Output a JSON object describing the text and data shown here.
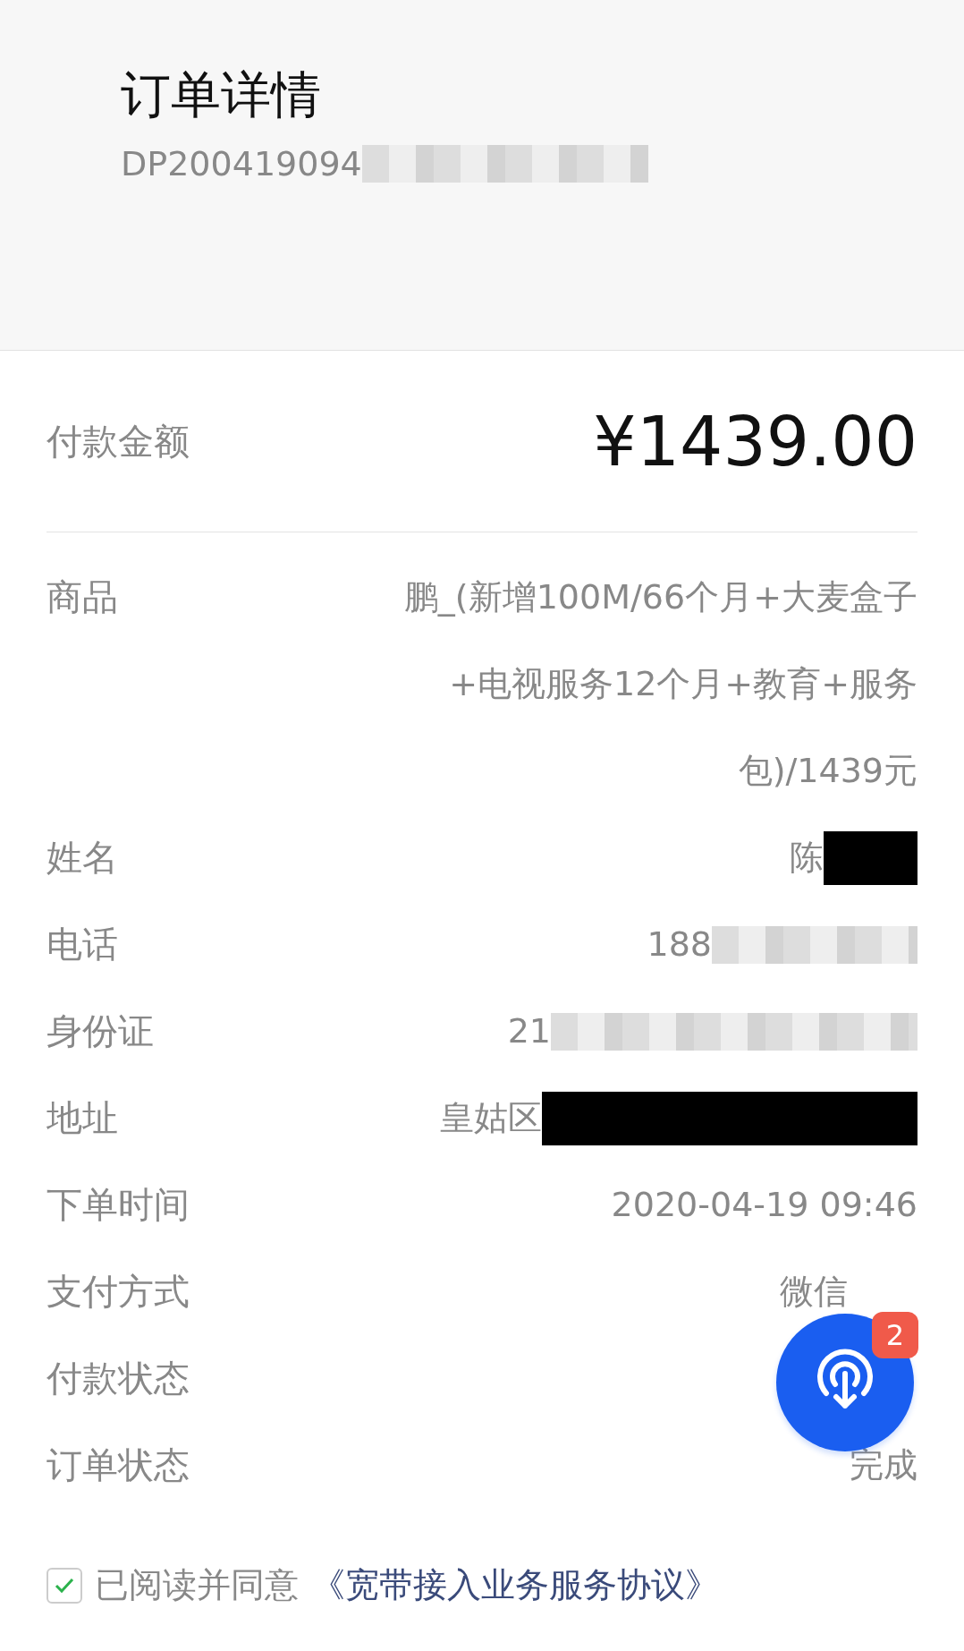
{
  "header": {
    "title": "订单详情",
    "order_number": "DP200419094",
    "kind": "pixel_redacted"
  },
  "amount": {
    "label": "付款金额",
    "value": "¥1439.00"
  },
  "fields": [
    {
      "label": "商品",
      "value": "鹏_(新增100M/66个月+大麦盒子+电视服务12个月+教育+服务包)/1439元"
    },
    {
      "label": "姓名",
      "value": "陈",
      "kind": "black_redacted"
    },
    {
      "label": "电话",
      "value": "188",
      "kind": "pixel_redacted"
    },
    {
      "label": "身份证",
      "value": "21",
      "kind": "pixel_redacted"
    },
    {
      "label": "地址",
      "value": "皇姑区",
      "kind": "black_redacted"
    },
    {
      "label": "下单时间",
      "value": "2020-04-19 09:46"
    },
    {
      "label": "支付方式",
      "value": "微信",
      "kind": "covered"
    },
    {
      "label": "付款状态"
    },
    {
      "label": "订单状态",
      "value": "完成"
    }
  ],
  "agreement": {
    "checked": true,
    "text": "已阅读并同意",
    "link": "《宽带接入业务服务协议》"
  },
  "float_button": {
    "badge": "2"
  }
}
